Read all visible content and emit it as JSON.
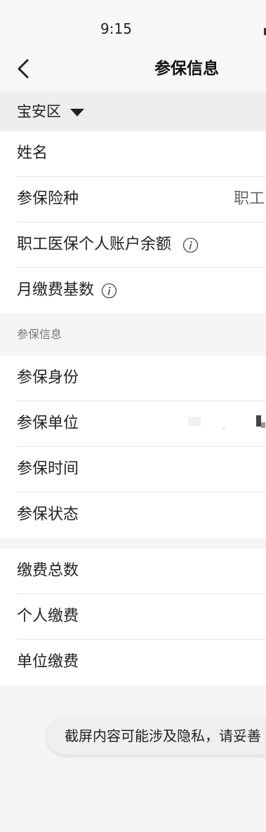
{
  "status_bar": {
    "time": "9:15"
  },
  "header": {
    "title": "参保信息"
  },
  "region": {
    "label": "宝安区"
  },
  "sections": [
    {
      "rows": [
        {
          "label": "姓名"
        },
        {
          "label": "参保险种",
          "value": "职工"
        },
        {
          "label": "职工医保个人账户余额",
          "icon": "info-icon"
        },
        {
          "label": "月缴费基数",
          "icon": "info-icon"
        }
      ]
    },
    {
      "header": "参保信息",
      "rows": [
        {
          "label": "参保身份"
        },
        {
          "label": "参保单位"
        },
        {
          "label": "参保时间"
        },
        {
          "label": "参保状态"
        }
      ]
    },
    {
      "rows": [
        {
          "label": "缴费总数"
        },
        {
          "label": "个人缴费"
        },
        {
          "label": "单位缴费"
        }
      ]
    }
  ],
  "toast": {
    "text": "截屏内容可能涉及隐私，请妥善"
  },
  "colors": {
    "page_bg": "#f5f5f5",
    "row_bg": "#ffffff",
    "text": "#222222",
    "muted": "#777777"
  }
}
